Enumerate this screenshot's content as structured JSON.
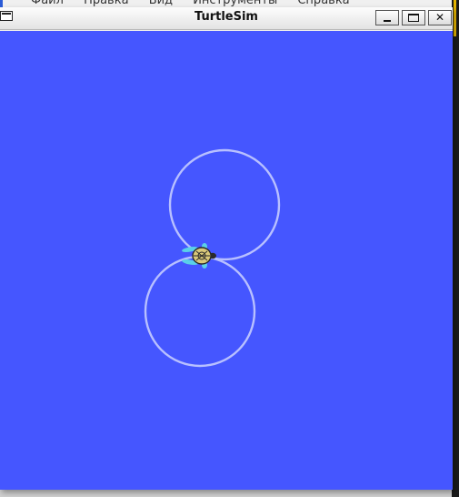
{
  "background_app": {
    "menu": [
      "Файл",
      "Правка",
      "Вид",
      "Инструменты",
      "Справка"
    ]
  },
  "window": {
    "title": "TurtleSim",
    "controls": {
      "minimize": "minimize",
      "maximize": "maximize",
      "close": "✕"
    }
  },
  "canvas": {
    "background_color": "#4556ff",
    "trail_color": "#b8c0ff",
    "turtle": {
      "icon": "turtle-icon",
      "shell_color": "#d9c87a",
      "body_color": "#2a2a2a",
      "flipper_color": "#5ad0e8"
    }
  },
  "colors": {
    "titlebar": "#efefef",
    "window_border": "#b8b8b8"
  }
}
